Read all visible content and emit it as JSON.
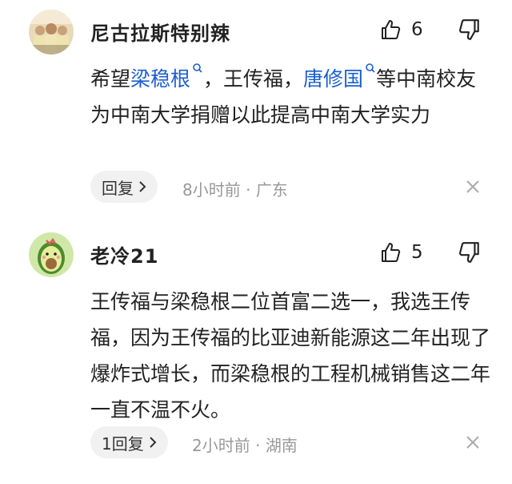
{
  "comments": [
    {
      "username": "尼古拉斯特别辣",
      "like_count": "6",
      "body": {
        "seg1": "希望",
        "mention1": "梁稳根",
        "seg2": "，王传福，",
        "mention2": "唐修国",
        "seg3": "等中南校友为中南大学捐赠以此提高中南大学实力"
      },
      "reply_label": "回复",
      "time": "8小时前",
      "separator": "·",
      "location": "广东"
    },
    {
      "username": "老冷21",
      "like_count": "5",
      "body": {
        "text": "王传福与梁稳根二位首富二选一，我选王传福，因为王传福的比亚迪新能源这二年出现了爆炸式增长，而梁稳根的工程机械销售这二年一直不温不火。"
      },
      "reply_label": "1回复",
      "time": "2小时前",
      "separator": "·",
      "location": "湖南"
    }
  ],
  "icons": {
    "like": "thumbs-up-icon",
    "dislike": "thumbs-down-icon",
    "mention_search": "search-icon",
    "reply_chevron": "chevron-right-icon",
    "dismiss": "close-icon"
  },
  "colors": {
    "mention": "#1a5fd0",
    "meta": "#999999",
    "reply_bg": "#f1f1f1"
  }
}
